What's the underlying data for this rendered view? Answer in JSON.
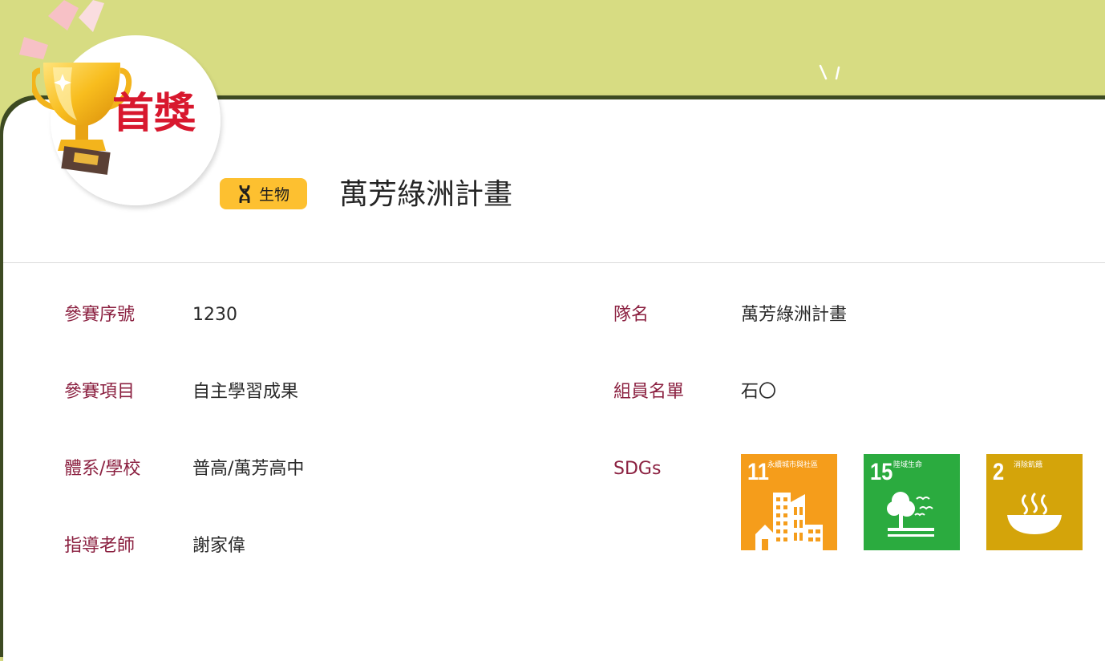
{
  "award": {
    "label": "首獎"
  },
  "category": {
    "label": "生物",
    "icon": "dna-icon"
  },
  "project": {
    "title": "萬芳綠洲計畫"
  },
  "fields": {
    "serial": {
      "label": "參賽序號",
      "value": "1230"
    },
    "item": {
      "label": "參賽項目",
      "value": "自主學習成果"
    },
    "school": {
      "label": "體系/學校",
      "value": "普高/萬芳高中"
    },
    "advisor": {
      "label": "指導老師",
      "value": "謝家偉"
    },
    "team": {
      "label": "隊名",
      "value": "萬芳綠洲計畫"
    },
    "members": {
      "label": "組員名單",
      "value": "石〇"
    },
    "sdgs": {
      "label": "SDGs"
    }
  },
  "sdgs": [
    {
      "number": "11",
      "name": "永續城市與社區",
      "color": "#f59d1b",
      "icon": "city-icon"
    },
    {
      "number": "15",
      "name": "陸域生命",
      "color": "#2bab3f",
      "icon": "tree-icon"
    },
    {
      "number": "2",
      "name": "消除飢餓",
      "color": "#d4a40a",
      "icon": "bowl-icon"
    }
  ],
  "colors": {
    "background": "#d7dc82",
    "label": "#8b2040",
    "badge": "#fdc030",
    "award_text": "#d8182e"
  }
}
